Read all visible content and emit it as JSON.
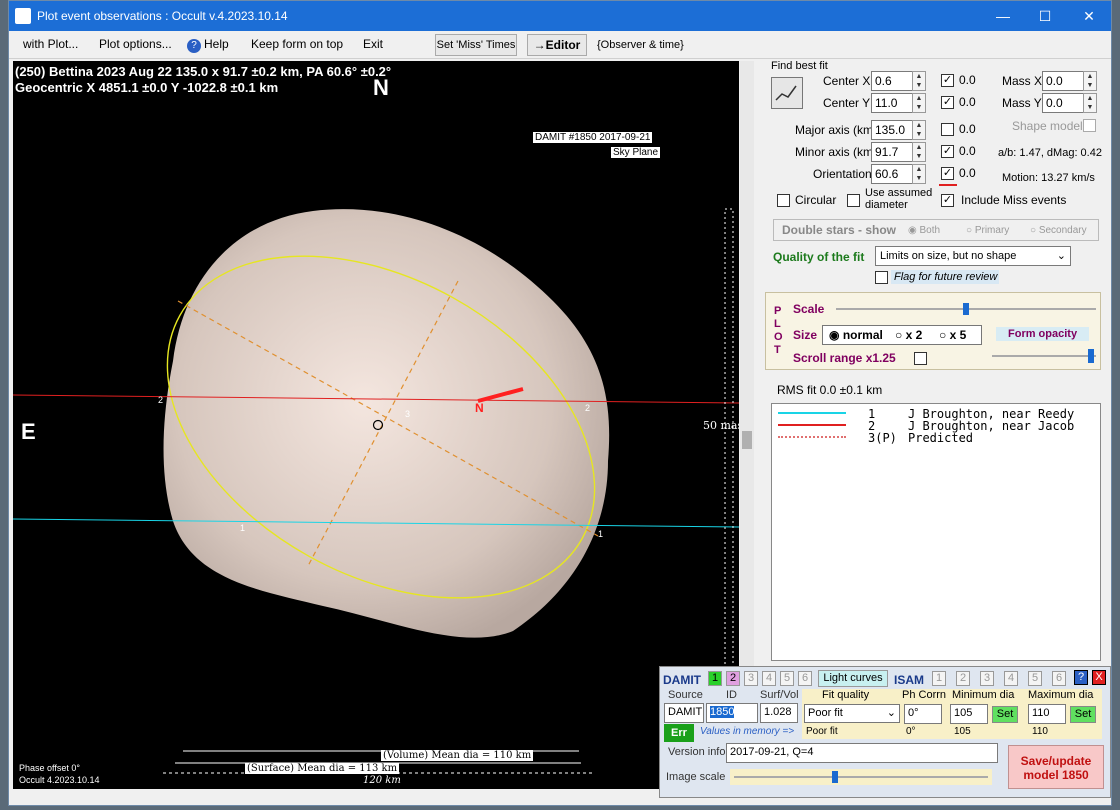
{
  "window": {
    "title": "Plot event observations : Occult v.4.2023.10.14",
    "minimize": "—",
    "maximize": "☐",
    "close": "✕"
  },
  "menu": {
    "with_plot": "with Plot...",
    "plot_options": "Plot options...",
    "help": "Help",
    "keep_on_top": "Keep form on top",
    "exit": "Exit",
    "set_miss": "Set 'Miss' Times",
    "editor": "→Editor",
    "observer_time": "{Observer & time}"
  },
  "plot": {
    "header1": "(250) Bettina  2023 Aug 22   135.0 x 91.7 ±0.2 km, PA 60.6° ±0.2°",
    "header2": "Geocentric  X  4851.1 ±0.0  Y -1022.8 ±0.1 km",
    "north": "N",
    "east": "E",
    "damit_tag": "DAMIT #1850 2017-09-21",
    "sky_plane": "Sky Plane",
    "scale_label": "50 mas",
    "chord_labels": [
      "2",
      "3",
      "2",
      "1",
      "1"
    ],
    "motion_n": "N",
    "phase_offset": "Phase offset 0°",
    "occult_ver": "Occult 4.2023.10.14",
    "volume_dia": "(Volume) Mean dia = 110 km",
    "surface_dia": "(Surface) Mean dia = 113 km",
    "scalebar_km": "120 km"
  },
  "findfit": {
    "title": "Find best fit",
    "center_x": {
      "label": "Center X",
      "value": "0.6",
      "check_val": "0.0"
    },
    "center_y": {
      "label": "Center Y",
      "value": "11.0",
      "check_val": "0.0"
    },
    "major": {
      "label": "Major axis (km)",
      "value": "135.0",
      "check_val": "0.0"
    },
    "minor": {
      "label": "Minor axis (km)",
      "value": "91.7",
      "check_val": "0.0"
    },
    "orient": {
      "label": "Orientation",
      "value": "60.6",
      "check_val": "0.0"
    },
    "mass_x": {
      "label": "Mass X",
      "value": "0.0"
    },
    "mass_y": {
      "label": "Mass Y",
      "value": "0.0"
    },
    "shape_model": "Shape model",
    "ab": "a/b: 1.47, dMag: 0.42",
    "motion": "Motion: 13.27 km/s",
    "circular": "Circular",
    "use_assumed": "Use assumed",
    "diameter": "diameter",
    "include_miss": "Include Miss events",
    "double_stars": "Double stars - show",
    "both": "Both",
    "primary": "Primary",
    "secondary": "Secondary",
    "quality_label": "Quality of the fit",
    "quality_value": "Limits on size, but no shape",
    "flag_review": "Flag for future review"
  },
  "plotctl": {
    "plot_letters": [
      "P",
      "L",
      "O",
      "T"
    ],
    "scale": "Scale",
    "size": "Size",
    "normal": "normal",
    "x2": "x 2",
    "x5": "x 5",
    "form_opacity": "Form opacity",
    "scroll_range": "Scroll range x1.25",
    "scale_level": 0.5,
    "opacity_level": 0.98
  },
  "rms": "RMS fit 0.0 ±0.1 km",
  "legend": [
    {
      "num": "1",
      "name": "J Broughton, near Reedy",
      "color": "#19d4e6"
    },
    {
      "num": "2",
      "name": "J Broughton, near Jacob",
      "color": "#e02020"
    },
    {
      "num": "3(P)",
      "name": "Predicted",
      "color": "#e07070"
    }
  ],
  "damit": {
    "title": "DAMIT",
    "nums": [
      "1",
      "2",
      "3",
      "4",
      "5",
      "6"
    ],
    "light_curves": "Light curves",
    "isam": "ISAM",
    "isam_nums": [
      "1",
      "2",
      "3",
      "4",
      "5",
      "6"
    ],
    "help": "?",
    "close": "X",
    "source_h": "Source",
    "id_h": "ID",
    "surfvol_h": "Surf/Vol",
    "source": "DAMIT",
    "id": "1850",
    "surfvol": "1.028",
    "fitq_h": "Fit quality",
    "phcorr_h": "Ph Corrn",
    "mindia_h": "Minimum dia",
    "maxdia_h": "Maximum dia",
    "fitq": "Poor fit",
    "phcorr": "0°",
    "mindia": "105",
    "maxdia": "110",
    "set": "Set",
    "err": "Err",
    "values_mem": "Values in memory =>",
    "mem_fitq": "Poor fit",
    "mem_ph": "0°",
    "mem_min": "105",
    "mem_max": "110",
    "version_label": "Version info",
    "version": "2017-09-21, Q=4",
    "image_scale": "Image scale",
    "image_scale_level": 0.4,
    "save": "Save/update model 1850"
  }
}
